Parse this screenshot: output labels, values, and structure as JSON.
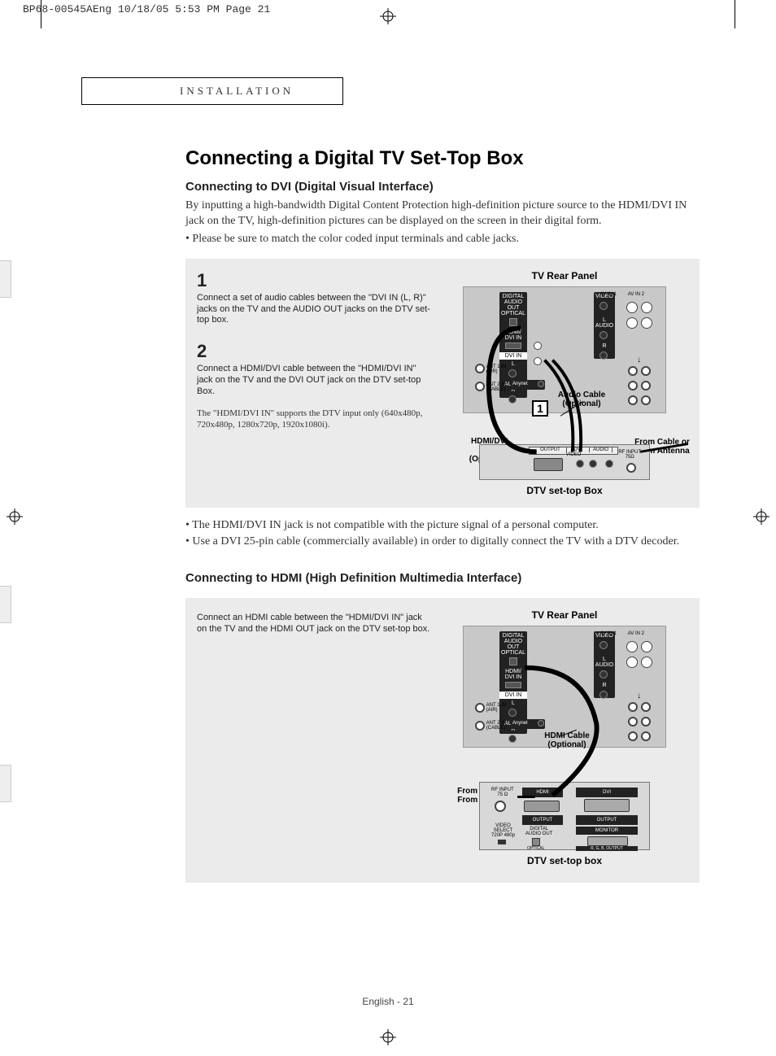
{
  "print_header": "BP68-00545AEng  10/18/05  5:53 PM  Page 21",
  "section_tab": "INSTALLATION",
  "title": "Connecting a Digital TV Set-Top Box",
  "dvi": {
    "subtitle": "Connecting to DVI (Digital Visual Interface)",
    "intro": "By inputting a high-bandwidth Digital Content Protection high-definition picture source to the HDMI/DVI IN jack on the TV, high-definition pictures can be displayed on the screen in their digital form.",
    "bullet1": "•  Please be sure to match the color coded input terminals and cable jacks.",
    "step1_num": "1",
    "step1_text": "Connect a set of audio cables between the \"DVI IN (L, R)\" jacks on the TV and the AUDIO OUT jacks on the DTV set-top box.",
    "step2_num": "2",
    "step2_text": "Connect a HDMI/DVI cable between the \"HDMI/DVI IN\" jack on the TV and the DVI OUT jack on the DTV set-top Box.",
    "step2_note": "The \"HDMI/DVI IN\" supports the DTV input only (640x480p, 720x480p, 1280x720p, 1920x1080i).",
    "panel_label": "TV Rear Panel",
    "audio_cable": "Audio Cable (Optional)",
    "hdmi_cable": "HDMI/DVI Cable (Optional)",
    "from_cable": "From Cable or From Antenna",
    "stb_label": "DTV set-top Box",
    "after_bullet1": "• The HDMI/DVI IN jack is not compatible with the picture signal of a personal computer.",
    "after_bullet2": "• Use a DVI 25-pin cable (commercially available) in order to digitally connect the TV with a DTV decoder."
  },
  "hdmi": {
    "subtitle": "Connecting to HDMI (High Definition Multimedia Interface)",
    "step_text": "Connect an HDMI cable between the \"HDMI/DVI IN\" jack on the TV and the HDMI  OUT jack on the DTV set-top box.",
    "panel_label": "TV Rear Panel",
    "hdmi_cable": "HDMI Cable (Optional)",
    "from_cable": "From Cable or From Antenna",
    "stb_label": "DTV set-top box"
  },
  "footer": "English - 21"
}
